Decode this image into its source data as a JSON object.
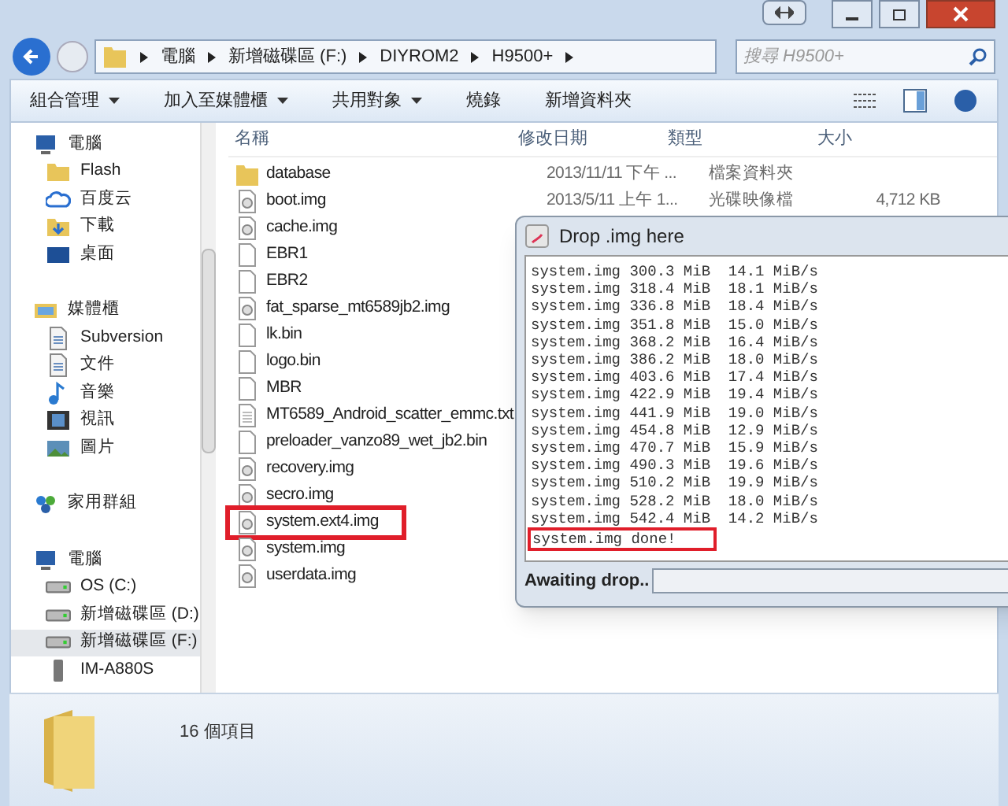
{
  "breadcrumb": [
    "電腦",
    "新增磁碟區 (F:)",
    "DIYROM2",
    "H9500+"
  ],
  "search": {
    "placeholder": "搜尋 H9500+"
  },
  "toolbar": [
    "組合管理",
    "加入至媒體櫃",
    "共用對象",
    "燒錄",
    "新增資料夾"
  ],
  "toolbar_dropdowns": [
    true,
    true,
    true,
    false,
    false
  ],
  "sidebar": {
    "groups": [
      {
        "items": [
          {
            "label": "電腦",
            "kind": "computer",
            "selected": false
          },
          {
            "label": "Flash",
            "kind": "folder",
            "selected": false
          },
          {
            "label": "百度云",
            "kind": "cloud",
            "selected": false
          },
          {
            "label": "下載",
            "kind": "download",
            "selected": false
          },
          {
            "label": "桌面",
            "kind": "desktop",
            "selected": false
          }
        ]
      },
      {
        "items": [
          {
            "label": "媒體櫃",
            "kind": "library",
            "selected": false
          },
          {
            "label": "Subversion",
            "kind": "doc",
            "selected": false
          },
          {
            "label": "文件",
            "kind": "doc",
            "selected": false
          },
          {
            "label": "音樂",
            "kind": "music",
            "selected": false
          },
          {
            "label": "視訊",
            "kind": "video",
            "selected": false
          },
          {
            "label": "圖片",
            "kind": "image",
            "selected": false
          }
        ]
      },
      {
        "items": [
          {
            "label": "家用群組",
            "kind": "homegroup",
            "selected": false
          }
        ]
      },
      {
        "items": [
          {
            "label": "電腦",
            "kind": "computer",
            "selected": false
          },
          {
            "label": "OS (C:)",
            "kind": "drive",
            "selected": false
          },
          {
            "label": "新增磁碟區 (D:)",
            "kind": "drive",
            "selected": false
          },
          {
            "label": "新增磁碟區 (F:)",
            "kind": "drive",
            "selected": true
          },
          {
            "label": "IM-A880S",
            "kind": "phone",
            "selected": false
          }
        ]
      }
    ]
  },
  "columns": [
    "名稱",
    "修改日期",
    "類型",
    "大小"
  ],
  "files": [
    {
      "name": "database",
      "kind": "folder",
      "date": "2013/11/11 下午 ...",
      "type": "檔案資料夾",
      "highlighted": false
    },
    {
      "name": "boot.img",
      "kind": "image",
      "date": "2013/5/11 上午 1...",
      "type": "光碟映像檔",
      "size": "4,712 KB",
      "highlighted": false
    },
    {
      "name": "cache.img",
      "kind": "image",
      "highlighted": false
    },
    {
      "name": "EBR1",
      "kind": "blank",
      "highlighted": false
    },
    {
      "name": "EBR2",
      "kind": "blank",
      "highlighted": false
    },
    {
      "name": "fat_sparse_mt6589jb2.img",
      "kind": "image",
      "highlighted": false
    },
    {
      "name": "lk.bin",
      "kind": "blank",
      "highlighted": false
    },
    {
      "name": "logo.bin",
      "kind": "blank",
      "highlighted": false
    },
    {
      "name": "MBR",
      "kind": "blank",
      "highlighted": false
    },
    {
      "name": "MT6589_Android_scatter_emmc.txt",
      "kind": "text",
      "highlighted": false
    },
    {
      "name": "preloader_vanzo89_wet_jb2.bin",
      "kind": "blank",
      "highlighted": false
    },
    {
      "name": "recovery.img",
      "kind": "image",
      "highlighted": false
    },
    {
      "name": "secro.img",
      "kind": "image",
      "highlighted": false
    },
    {
      "name": "system.ext4.img",
      "kind": "image",
      "highlighted": true
    },
    {
      "name": "system.img",
      "kind": "image",
      "highlighted": false
    },
    {
      "name": "userdata.img",
      "kind": "image",
      "highlighted": false
    }
  ],
  "status_bar": {
    "count": "16 個項目"
  },
  "dialog": {
    "title": "Drop .img here",
    "log": [
      {
        "text": "system.img 300.3 MiB  14.1 MiB/s",
        "highlighted": false
      },
      {
        "text": "system.img 318.4 MiB  18.1 MiB/s",
        "highlighted": false
      },
      {
        "text": "system.img 336.8 MiB  18.4 MiB/s",
        "highlighted": false
      },
      {
        "text": "system.img 351.8 MiB  15.0 MiB/s",
        "highlighted": false
      },
      {
        "text": "system.img 368.2 MiB  16.4 MiB/s",
        "highlighted": false
      },
      {
        "text": "system.img 386.2 MiB  18.0 MiB/s",
        "highlighted": false
      },
      {
        "text": "system.img 403.6 MiB  17.4 MiB/s",
        "highlighted": false
      },
      {
        "text": "system.img 422.9 MiB  19.4 MiB/s",
        "highlighted": false
      },
      {
        "text": "system.img 441.9 MiB  19.0 MiB/s",
        "highlighted": false
      },
      {
        "text": "system.img 454.8 MiB  12.9 MiB/s",
        "highlighted": false
      },
      {
        "text": "system.img 470.7 MiB  15.9 MiB/s",
        "highlighted": false
      },
      {
        "text": "system.img 490.3 MiB  19.6 MiB/s",
        "highlighted": false
      },
      {
        "text": "system.img 510.2 MiB  19.9 MiB/s",
        "highlighted": false
      },
      {
        "text": "system.img 528.2 MiB  18.0 MiB/s",
        "highlighted": false
      },
      {
        "text": "system.img 542.4 MiB  14.2 MiB/s",
        "highlighted": false
      },
      {
        "text": "system.img done!",
        "highlighted": true
      }
    ],
    "status": "Awaiting drop.."
  }
}
